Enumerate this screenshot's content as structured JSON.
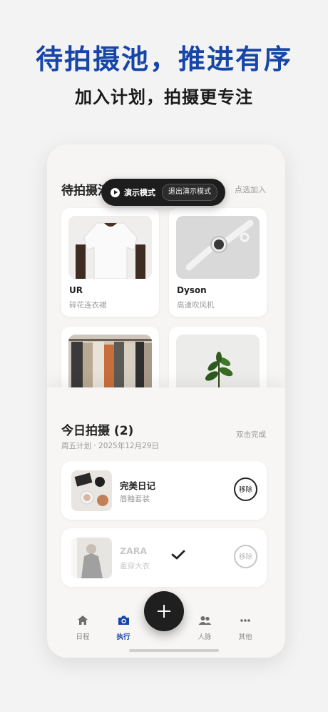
{
  "hero": {
    "title": "待拍摄池，推进有序",
    "subtitle": "加入计划，拍摄更专注"
  },
  "pool": {
    "title": "待拍摄池",
    "action": "点选加入",
    "items": [
      {
        "brand": "UR",
        "name": "碎花连衣裙",
        "image": "white-tshirt-photo"
      },
      {
        "brand": "Dyson",
        "name": "高速吹风机",
        "image": "smartwatch-photo"
      },
      {
        "brand": "",
        "name": "",
        "image": "clothing-rack-photo"
      },
      {
        "brand": "",
        "name": "",
        "image": "plant-photo"
      }
    ]
  },
  "demo": {
    "label": "演示模式",
    "exit_label": "退出演示模式"
  },
  "today": {
    "title": "今日拍摄 (2)",
    "subtitle": "周五计划 · 2025年12月29日",
    "action": "双击完成",
    "tasks": [
      {
        "brand": "完美日记",
        "name": "唇釉套装",
        "remove_label": "移除",
        "done": false,
        "image": "cosmetics-photo"
      },
      {
        "brand": "ZARA",
        "name": "羞穿大衣",
        "remove_label": "移除",
        "done": true,
        "image": "coat-photo"
      }
    ]
  },
  "tabs": [
    {
      "label": "日程",
      "icon": "home-icon",
      "active": false
    },
    {
      "label": "执行",
      "icon": "camera-icon",
      "active": true
    },
    {
      "label": "人脉",
      "icon": "people-icon",
      "active": false
    },
    {
      "label": "其他",
      "icon": "more-icon",
      "active": false
    }
  ],
  "colors": {
    "accent": "#1746a8",
    "dark": "#1d1d1d"
  }
}
